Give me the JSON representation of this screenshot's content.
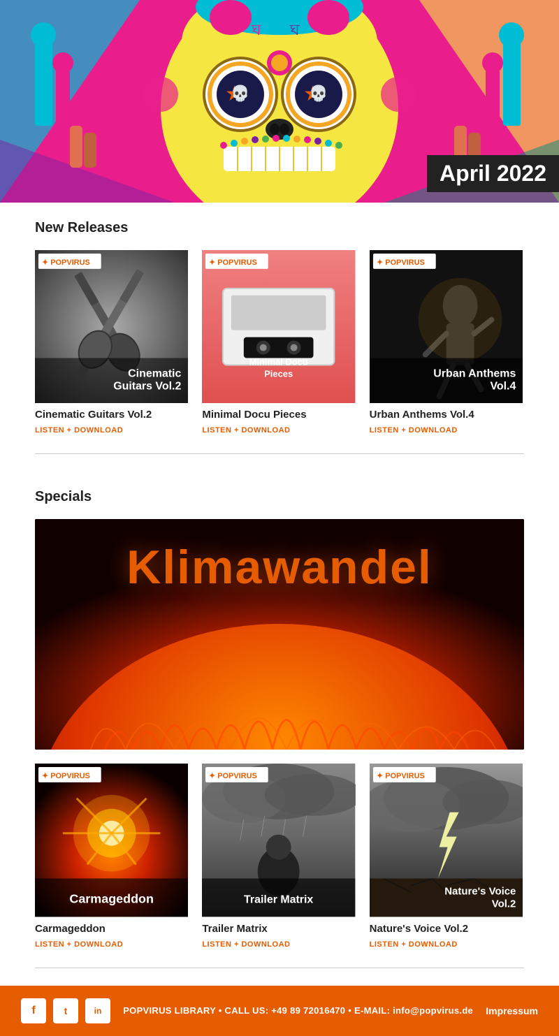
{
  "hero": {
    "date_badge": "April 2022"
  },
  "new_releases": {
    "section_title": "New Releases",
    "albums": [
      {
        "id": "cinematic",
        "title": "Cinematic Guitars Vol.2",
        "cover_label": "Cinematic\nGuitars Vol.2",
        "listen_label": "LISTEN + DOWNLOAD",
        "badge": "POPVIRUS"
      },
      {
        "id": "minimal",
        "title": "Minimal Docu Pieces",
        "cover_label": "Minimal Docu\nPieces",
        "listen_label": "LISTEN + DOWNLOAD",
        "badge": "POPVIRUS"
      },
      {
        "id": "urban",
        "title": "Urban Anthems Vol.4",
        "cover_label": "Urban Anthems\nVol.4",
        "listen_label": "LISTEN + DOWNLOAD",
        "badge": "POPVIRUS"
      }
    ]
  },
  "specials": {
    "section_title": "Specials",
    "banner_title": "Klimawandel",
    "albums": [
      {
        "id": "carmageddon",
        "title": "Carmageddon",
        "cover_label": "Carmageddon",
        "listen_label": "LISTEN + DOWNLOAD",
        "badge": "POPVIRUS"
      },
      {
        "id": "trailer",
        "title": "Trailer Matrix",
        "cover_label": "Trailer Matrix",
        "listen_label": "LISTEN + DOWNLOAD",
        "badge": "POPVIRUS"
      },
      {
        "id": "nature",
        "title": "Nature's Voice Vol.2",
        "cover_label": "Nature's Voice\nVol.2",
        "listen_label": "LISTEN + DOWNLOAD",
        "badge": "POPVIRUS"
      }
    ]
  },
  "footer": {
    "info": "POPVIRUS LIBRARY • CALL US: +49 89 72016470 • E-MAIL: info@popvirus.de",
    "impressum": "Impressum",
    "socials": [
      {
        "name": "facebook",
        "label": "f"
      },
      {
        "name": "twitter",
        "label": "t"
      },
      {
        "name": "linkedin",
        "label": "in"
      }
    ]
  }
}
